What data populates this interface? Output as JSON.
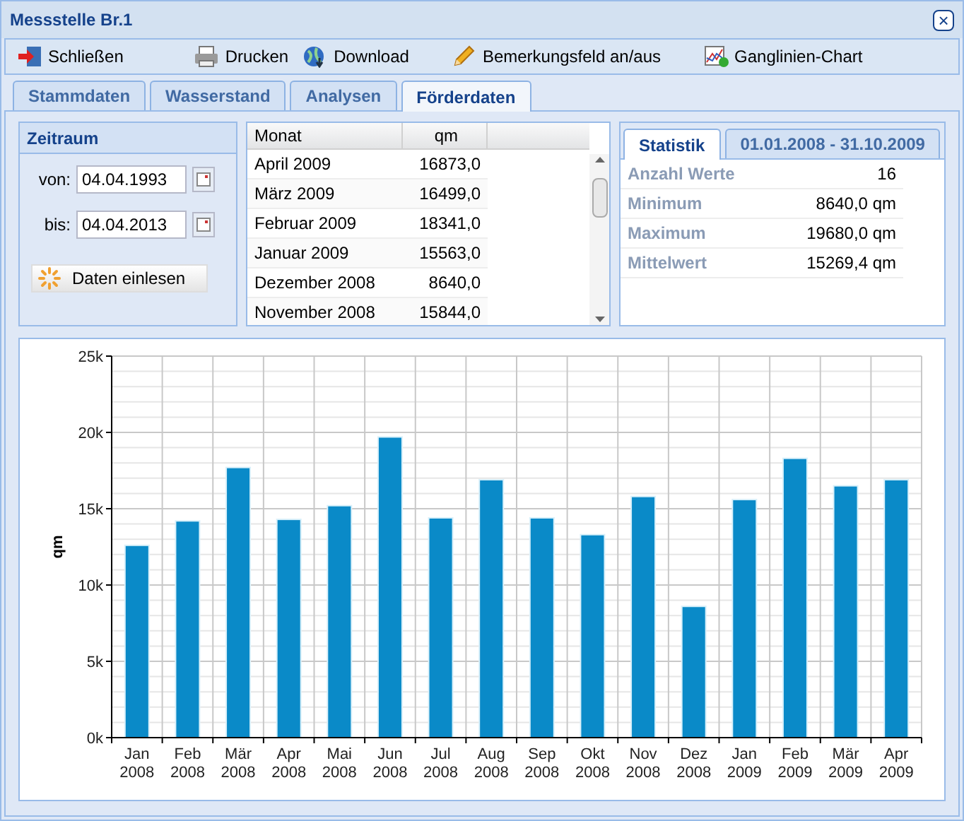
{
  "window": {
    "title": "Messstelle Br.1",
    "close": "×"
  },
  "toolbar": [
    {
      "label": "Schließen",
      "kind": "exit"
    },
    {
      "label": "Drucken",
      "kind": "print"
    },
    {
      "label": "Download",
      "kind": "download"
    },
    {
      "label": "Bemerkungsfeld an/aus",
      "kind": "pencil"
    },
    {
      "label": "Ganglinien-Chart",
      "kind": "chart"
    }
  ],
  "tabs": [
    {
      "label": "Stammdaten",
      "selected": false
    },
    {
      "label": "Wasserstand",
      "selected": false
    },
    {
      "label": "Analysen",
      "selected": false
    },
    {
      "label": "Förderdaten",
      "selected": true
    }
  ],
  "zeitraum": {
    "title": "Zeitraum",
    "from_label": "von:",
    "from_value": "04.04.1993",
    "to_label": "bis:",
    "to_value": "04.04.2013",
    "button": "Daten einlesen"
  },
  "grid": {
    "columns": [
      "Monat",
      "qm"
    ],
    "rows": [
      [
        "April 2009",
        "16873,0"
      ],
      [
        "März 2009",
        "16499,0"
      ],
      [
        "Februar 2009",
        "18341,0"
      ],
      [
        "Januar 2009",
        "15563,0"
      ],
      [
        "Dezember 2008",
        "8640,0"
      ],
      [
        "November 2008",
        "15844,0"
      ]
    ]
  },
  "stats": {
    "tabs": [
      {
        "label": "Statistik",
        "selected": true
      },
      {
        "label": "01.01.2008 - 31.10.2009",
        "selected": false
      }
    ],
    "rows": [
      [
        "Anzahl Werte",
        "16"
      ],
      [
        "Minimum",
        "8640,0 qm"
      ],
      [
        "Maximum",
        "19680,0 qm"
      ],
      [
        "Mittelwert",
        "15269,4 qm"
      ]
    ]
  },
  "chart_data": {
    "type": "bar",
    "ylabel": "qm",
    "categories": [
      "Jan 2008",
      "Feb 2008",
      "Mär 2008",
      "Apr 2008",
      "Mai 2008",
      "Jun 2008",
      "Jul 2008",
      "Aug 2008",
      "Sep 2008",
      "Okt 2008",
      "Nov 2008",
      "Dez 2008",
      "Jan 2009",
      "Feb 2009",
      "Mär 2009",
      "Apr 2009"
    ],
    "series": [
      {
        "color": "#0a8ac8",
        "values": [
          12600,
          14200,
          17700,
          14300,
          15200,
          19700,
          14400,
          16900,
          14400,
          13300,
          15800,
          8600,
          15600,
          18300,
          16500,
          16900
        ]
      }
    ],
    "grid": true,
    "ylim": [
      0,
      25000
    ],
    "yticks": [
      {
        "value": 0,
        "label": "0k"
      },
      {
        "value": 5000,
        "label": "5k"
      },
      {
        "value": 10000,
        "label": "10k"
      },
      {
        "value": 15000,
        "label": "15k"
      },
      {
        "value": 20000,
        "label": "20k"
      },
      {
        "value": 25000,
        "label": "25k"
      }
    ]
  }
}
